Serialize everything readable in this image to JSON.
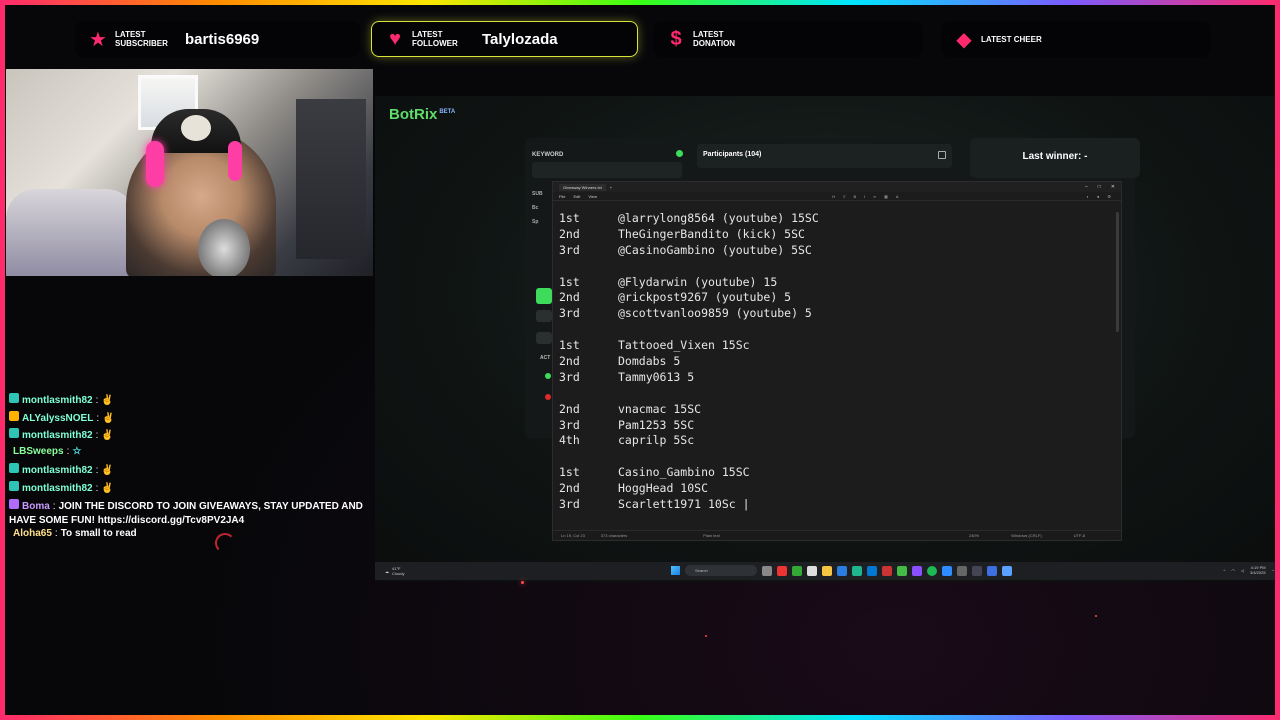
{
  "alerts": [
    {
      "icon": "star-icon",
      "label": "LATEST SUBSCRIBER",
      "value": "bartis6969"
    },
    {
      "icon": "heart-icon",
      "label": "LATEST FOLLOWER",
      "value": "Talylozada"
    },
    {
      "icon": "dollar-icon",
      "label": "LATEST DONATION",
      "value": ""
    },
    {
      "icon": "diamond-icon",
      "label": "LATEST CHEER",
      "value": ""
    }
  ],
  "chat": [
    {
      "user": "montlasmith82",
      "text": "✌"
    },
    {
      "user": "ALYalyssNOEL",
      "text": "✌"
    },
    {
      "user": "montlasmith82",
      "text": "✌"
    },
    {
      "user": "LBSweeps",
      "text": "☆"
    },
    {
      "user": "montlasmith82",
      "text": "✌"
    },
    {
      "user": "montlasmith82",
      "text": "✌"
    },
    {
      "user": "Boma",
      "text": "JOIN THE DISCORD TO JOIN GIVEAWAYS, STAY UPDATED AND HAVE SOME FUN! https://discord.gg/Tcv8PV2JA4"
    },
    {
      "user": "Aloha65",
      "text": "To small to read"
    }
  ],
  "botrix": {
    "brand": "BotRix",
    "beta": "BETA",
    "keyword_label": "KEYWORD",
    "participants_label": "Participants (104)",
    "last_winner": "Last winner: -",
    "side_labels": [
      "SUB",
      "Bc",
      "Sp"
    ],
    "actions_label": "ACT"
  },
  "notepad": {
    "tab_title": "Giveaway Winners.txt",
    "menu": [
      "File",
      "Edit",
      "View"
    ],
    "lines": [
      {
        "rank": "1st",
        "text": "@larrylong8564 (youtube) 15SC"
      },
      {
        "rank": "2nd",
        "text": "TheGingerBandito (kick) 5SC"
      },
      {
        "rank": "3rd",
        "text": "@CasinoGambino (youtube) 5SC"
      },
      {
        "rank": "",
        "text": ""
      },
      {
        "rank": "1st",
        "text": "@Flydarwin (youtube) 15"
      },
      {
        "rank": "2nd",
        "text": "@rickpost9267 (youtube) 5"
      },
      {
        "rank": "3rd",
        "text": "@scottvanloo9859 (youtube) 5"
      },
      {
        "rank": "",
        "text": ""
      },
      {
        "rank": "1st",
        "text": "Tattooed_Vixen 15Sc"
      },
      {
        "rank": "2nd",
        "text": "Domdabs 5"
      },
      {
        "rank": "3rd",
        "text": "Tammy0613 5"
      },
      {
        "rank": "",
        "text": ""
      },
      {
        "rank": "2nd",
        "text": "vnacmac 15SC"
      },
      {
        "rank": "3rd",
        "text": "Pam1253 5SC"
      },
      {
        "rank": "4th",
        "text": "caprilp 5Sc"
      },
      {
        "rank": "",
        "text": ""
      },
      {
        "rank": "1st",
        "text": "Casino_Gambino 15SC"
      },
      {
        "rank": "2nd",
        "text": "HoggHead 10SC"
      },
      {
        "rank": "3rd",
        "text": "Scarlett1971 10Sc |"
      }
    ],
    "status": {
      "position": "Ln 19, Col 23",
      "chars": "373 characters",
      "format": "Plain text",
      "zoom": "240%",
      "eol": "Windows (CRLF)",
      "encoding": "UTF-8"
    }
  },
  "taskbar": {
    "weather_temp": "41°F",
    "weather_desc": "Cloudy",
    "search_placeholder": "Search",
    "clock_time": "4:19 PM",
    "clock_date": "3/4/2025"
  },
  "colors": {
    "accent_green": "#5fdc6a",
    "follower_border": "#d8e43a",
    "headset_pink": "#ff3ea5"
  }
}
